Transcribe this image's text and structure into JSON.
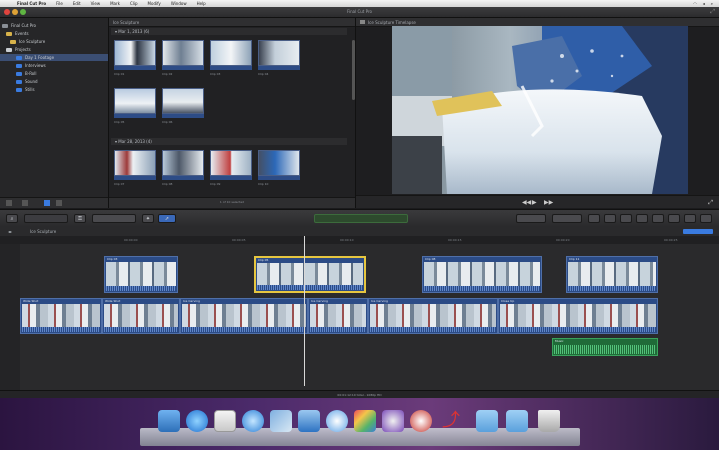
{
  "menu_bar": {
    "items": [
      "Final Cut Pro",
      "File",
      "Edit",
      "View",
      "Mark",
      "Clip",
      "Modify",
      "Window",
      "Help"
    ]
  },
  "window": {
    "title": "Final Cut Pro"
  },
  "library": {
    "items": [
      {
        "label": "Final Cut Pro",
        "icon": "library-icon"
      },
      {
        "label": "Events",
        "icon": "folder-icon"
      },
      {
        "label": "Ice Sculpture",
        "icon": "folder-icon"
      },
      {
        "label": "Projects",
        "icon": "event-icon"
      },
      {
        "label": "Day 1 Footage",
        "icon": "event-icon"
      },
      {
        "label": "Interviews",
        "icon": "event-icon"
      },
      {
        "label": "B-Roll",
        "icon": "event-icon"
      },
      {
        "label": "Sound",
        "icon": "event-icon"
      },
      {
        "label": "Stills",
        "icon": "event-icon"
      }
    ]
  },
  "browser": {
    "header": "Ice Sculpture",
    "groups": [
      {
        "title": "Mar 1, 2013 (6)"
      },
      {
        "title": "Mar 28, 2013 (4)"
      }
    ],
    "clips": [
      {
        "caption": "Clip 01"
      },
      {
        "caption": "Clip 02"
      },
      {
        "caption": "Clip 03"
      },
      {
        "caption": "Clip 04"
      },
      {
        "caption": "Clip 05"
      },
      {
        "caption": "Clip 06"
      },
      {
        "caption": "Clip 07"
      },
      {
        "caption": "Clip 08"
      },
      {
        "caption": "Clip 09"
      },
      {
        "caption": "Clip 10"
      }
    ],
    "footer": "1 of 10 selected"
  },
  "viewer": {
    "header": "Ice Sculpture Timelapse"
  },
  "timeline": {
    "title": "Ice Sculpture",
    "ruler": [
      "00:00:00",
      "00:00:05",
      "00:00:10",
      "00:00:15",
      "00:00:20",
      "00:00:25"
    ],
    "connected": [
      {
        "label": "Clip 03"
      },
      {
        "label": "Clip 05"
      },
      {
        "label": "Clip 08"
      },
      {
        "label": "Clip 11"
      }
    ],
    "primary": [
      {
        "label": "Wide Shot"
      },
      {
        "label": "Wide Shot"
      },
      {
        "label": "Ice Carving"
      },
      {
        "label": "Ice Carving"
      },
      {
        "label": "Ice Carving"
      },
      {
        "label": "Close Up"
      }
    ],
    "audio": {
      "label": "Music"
    },
    "status": "00:01:12:10 total - 1080p HD"
  },
  "dock": {
    "apps": [
      "finder-icon",
      "app-store-icon",
      "calendar-icon",
      "safari-icon",
      "photos-icon",
      "mail-icon",
      "itunes-icon",
      "final-cut-icon",
      "photo-booth-icon",
      "tool-icon",
      "folder-icon",
      "folder-icon",
      "trash-icon"
    ]
  }
}
